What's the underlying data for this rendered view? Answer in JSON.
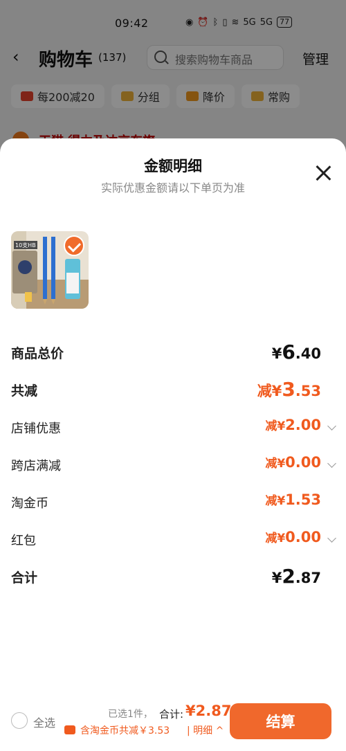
{
  "status_bar": {
    "time": "09:42",
    "icons": [
      "eye-icon",
      "alarm-icon",
      "bluetooth-icon",
      "vibrate-icon",
      "wifi-icon"
    ],
    "net1": "5G",
    "net2": "5G",
    "battery": "77"
  },
  "header": {
    "title": "购物车",
    "count": "(137)",
    "search_placeholder": "搜索购物车商品",
    "manage": "管理"
  },
  "chips": [
    {
      "label": "每200减20"
    },
    {
      "label": "分组"
    },
    {
      "label": "降价"
    },
    {
      "label": "常购"
    }
  ],
  "shop_partial": {
    "name": "天猫 得力及达京东旗"
  },
  "sheet": {
    "title": "金额明细",
    "subtitle": "实际优惠金额请以下单页为准",
    "rows": {
      "subtotal": {
        "label": "商品总价",
        "currency": "¥",
        "int": "6",
        "dec": ".40"
      },
      "discount": {
        "label": "共减",
        "prefix": "减¥",
        "int": "3",
        "dec": ".53"
      },
      "shop": {
        "label": "店铺优惠",
        "prefix": "减¥",
        "int": "2",
        "dec": ".00"
      },
      "cross": {
        "label": "跨店满减",
        "prefix": "减¥",
        "int": "0",
        "dec": ".00"
      },
      "coin": {
        "label": "淘金币",
        "prefix": "减¥",
        "int": "1",
        "dec": ".53"
      },
      "redpack": {
        "label": "红包",
        "prefix": "减¥",
        "int": "0",
        "dec": ".00"
      },
      "total": {
        "label": "合计",
        "currency": "¥",
        "int": "2",
        "dec": ".87"
      }
    },
    "product_tag": "10支HB"
  },
  "bottom_bar": {
    "select_all": "全选",
    "selected": "已选1件，",
    "total_label": "合计:",
    "total_value": "¥2.87",
    "coin_line": "含淘金币共减￥3.53",
    "detail": "| 明细 ^",
    "checkout": "结算"
  },
  "colors": {
    "accent": "#f05a1e",
    "checkout_bg": "#f0682c"
  }
}
